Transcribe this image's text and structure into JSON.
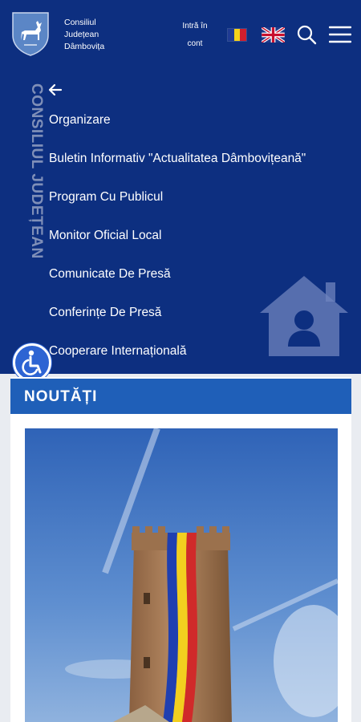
{
  "header": {
    "org_name": [
      "Consiliul",
      "Județean",
      "Dâmbovița"
    ],
    "login_label": "Intră în cont",
    "languages": [
      "ro-flag",
      "uk-flag"
    ],
    "icons": [
      "deer-crest-logo",
      "search-icon",
      "hamburger-menu-icon"
    ]
  },
  "menu": {
    "vertical_title": "CONSILIUL JUDEȚEAN",
    "items": [
      "Organizare",
      "Buletin Informativ \"Actualitatea Dâmbovițeană\"",
      "Program Cu Publicul",
      "Monitor Oficial Local",
      "Comunicate De Presă",
      "Conferințe De Presă",
      "Cooperare Internațională"
    ]
  },
  "news": {
    "title": "NOUTĂȚI",
    "image": "Turnul Chindiei tower with tricolor flag"
  },
  "colors": {
    "primary": "#0d2f80",
    "news_header": "#1f5fb8",
    "accessibility": "#2d64d3"
  }
}
